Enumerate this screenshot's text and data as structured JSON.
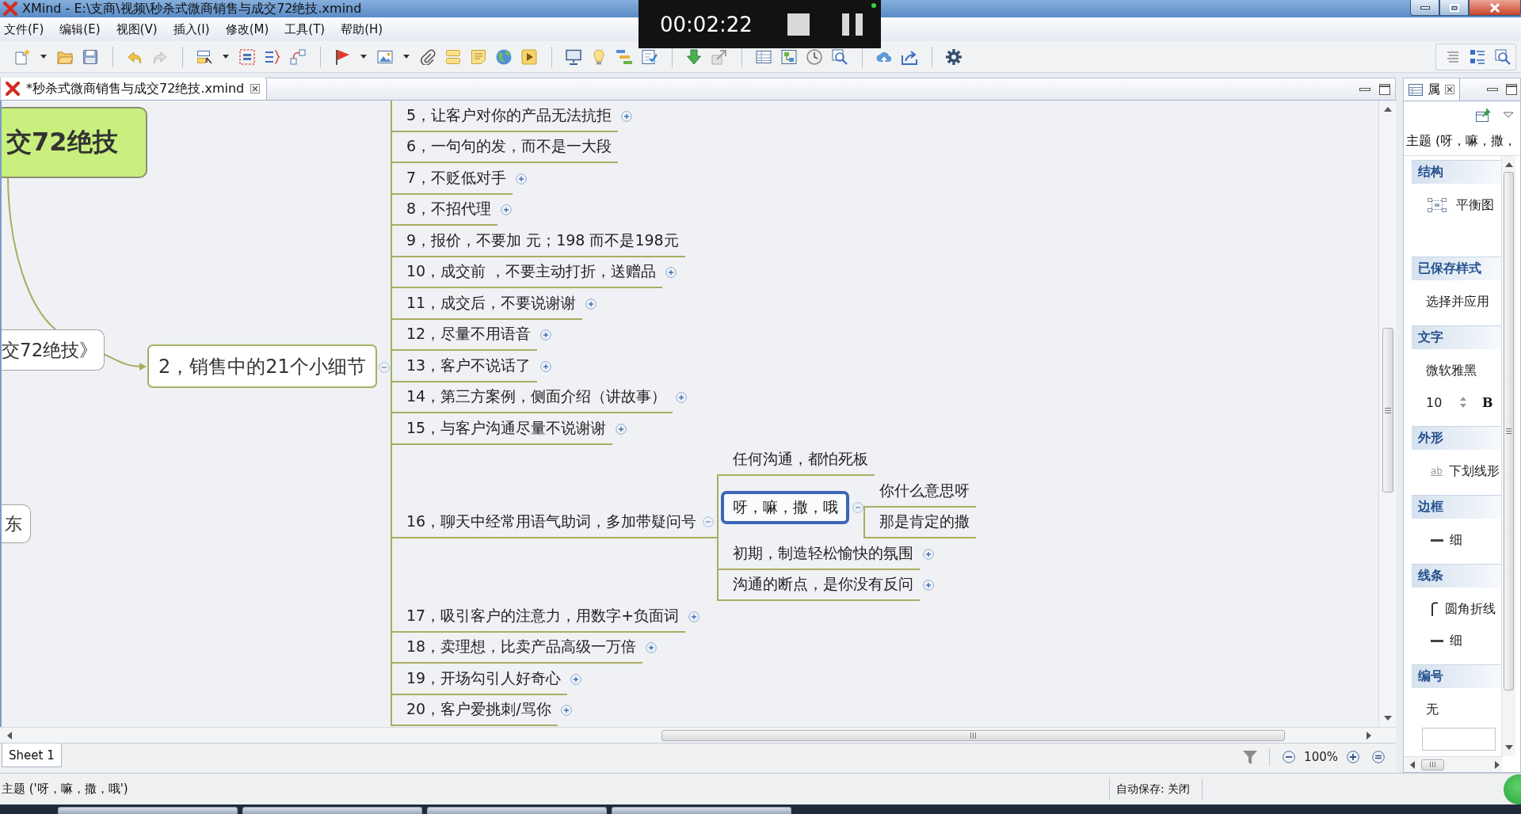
{
  "window": {
    "title": "XMind - E:\\支商\\视频\\秒杀式微商销售与成交72绝技.xmind"
  },
  "menu": [
    "文件(F)",
    "编辑(E)",
    "视图(V)",
    "插入(I)",
    "修改(M)",
    "工具(T)",
    "帮助(H)"
  ],
  "recorder": {
    "time": "00:02:22"
  },
  "editor_tabs": [
    {
      "label": "*秒杀式微商销售与成交72绝技.xmind",
      "selected": true
    }
  ],
  "mind_map": {
    "central_topic": {
      "label": "交72绝技",
      "selected": false
    },
    "topics": [
      {
        "label": "交72绝技》",
        "selected": false,
        "children": [
          {
            "label": "2，销售中的21个小细节",
            "selected": false,
            "collapsed": false,
            "children": [
              {
                "label": "5，让客户对你的产品无法抗拒",
                "selected": false,
                "collapsed": true
              },
              {
                "label": "6，一句句的发，而不是一大段",
                "selected": false,
                "collapsed": false
              },
              {
                "label": "7，不贬低对手",
                "selected": false,
                "collapsed": true
              },
              {
                "label": "8，不招代理",
                "selected": false,
                "collapsed": true
              },
              {
                "label": "9，报价，不要加 元；198 而不是198元",
                "selected": false,
                "collapsed": false
              },
              {
                "label": "10，成交前 ，不要主动打折，送赠品",
                "selected": false,
                "collapsed": true
              },
              {
                "label": "11，成交后，不要说谢谢",
                "selected": false,
                "collapsed": true
              },
              {
                "label": "12，尽量不用语音",
                "selected": false,
                "collapsed": true
              },
              {
                "label": "13，客户不说话了",
                "selected": false,
                "collapsed": true
              },
              {
                "label": "14，第三方案例，侧面介绍（讲故事）",
                "selected": false,
                "collapsed": true
              },
              {
                "label": "15，与客户沟通尽量不说谢谢",
                "selected": false,
                "collapsed": true
              },
              {
                "label": "16，聊天中经常用语气助词，多加带疑问号",
                "selected": false,
                "collapsed": false,
                "children": [
                  {
                    "label": "任何沟通，都怕死板",
                    "selected": false,
                    "collapsed": false
                  },
                  {
                    "label": "呀，嘛，撒，哦",
                    "selected": true,
                    "collapsed": false,
                    "children": [
                      {
                        "label": "你什么意思呀",
                        "selected": false,
                        "collapsed": false
                      },
                      {
                        "label": "那是肯定的撒",
                        "selected": false,
                        "collapsed": false
                      }
                    ]
                  },
                  {
                    "label": "初期，制造轻松愉快的氛围",
                    "selected": false,
                    "collapsed": true
                  },
                  {
                    "label": "沟通的断点，是你没有反问",
                    "selected": false,
                    "collapsed": true
                  }
                ]
              },
              {
                "label": "17，吸引客户的注意力，用数字+负面词",
                "selected": false,
                "collapsed": true
              },
              {
                "label": "18，卖理想，比卖产品高级一万倍",
                "selected": false,
                "collapsed": true
              },
              {
                "label": "19，开场勾引人好奇心",
                "selected": false,
                "collapsed": true
              },
              {
                "label": "20，客户爱挑刺/骂你",
                "selected": false,
                "collapsed": true
              }
            ]
          }
        ]
      },
      {
        "label": "东",
        "selected": false
      }
    ]
  },
  "sheet_tabs": [
    {
      "label": "Sheet 1",
      "selected": true
    }
  ],
  "zoom": "100%",
  "status_bar": {
    "selection": "主题 ('呀，嘛，撒，哦')",
    "autosave": "自动保存: 关闭"
  },
  "properties_panel": {
    "tabs": [
      {
        "label": "属",
        "selected": true
      }
    ],
    "subject": "主题 (呀，嘛，撒，",
    "sections": [
      {
        "title": "结构",
        "items": [
          {
            "kind": "structure",
            "label": "平衡图"
          }
        ]
      },
      {
        "title": "已保存样式",
        "items": [
          {
            "kind": "text",
            "label": "选择并应用"
          }
        ]
      },
      {
        "title": "文字",
        "items": [
          {
            "kind": "text",
            "label": "微软雅黑"
          },
          {
            "kind": "font_size",
            "value": "10",
            "bold_label": "B"
          }
        ]
      },
      {
        "title": "外形",
        "items": [
          {
            "kind": "shape",
            "sample": "ab",
            "label": "下划线形"
          }
        ]
      },
      {
        "title": "边框",
        "items": [
          {
            "kind": "weight",
            "label": "细"
          }
        ]
      },
      {
        "title": "线条",
        "items": [
          {
            "kind": "elbow",
            "label": "圆角折线"
          },
          {
            "kind": "weight",
            "label": "细"
          }
        ]
      },
      {
        "title": "编号",
        "items": [
          {
            "kind": "text",
            "label": "无"
          },
          {
            "kind": "input"
          }
        ]
      }
    ]
  }
}
